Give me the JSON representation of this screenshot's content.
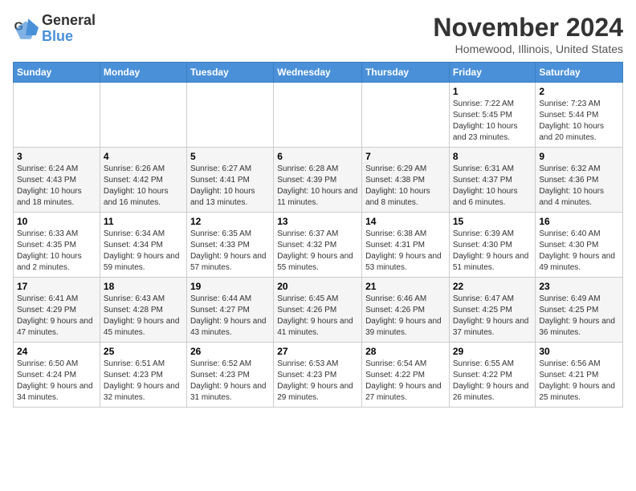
{
  "logo": {
    "general": "General",
    "blue": "Blue"
  },
  "title": {
    "month": "November 2024",
    "location": "Homewood, Illinois, United States"
  },
  "weekdays": [
    "Sunday",
    "Monday",
    "Tuesday",
    "Wednesday",
    "Thursday",
    "Friday",
    "Saturday"
  ],
  "weeks": [
    [
      {
        "day": "",
        "info": ""
      },
      {
        "day": "",
        "info": ""
      },
      {
        "day": "",
        "info": ""
      },
      {
        "day": "",
        "info": ""
      },
      {
        "day": "",
        "info": ""
      },
      {
        "day": "1",
        "info": "Sunrise: 7:22 AM\nSunset: 5:45 PM\nDaylight: 10 hours and 23 minutes."
      },
      {
        "day": "2",
        "info": "Sunrise: 7:23 AM\nSunset: 5:44 PM\nDaylight: 10 hours and 20 minutes."
      }
    ],
    [
      {
        "day": "3",
        "info": "Sunrise: 6:24 AM\nSunset: 4:43 PM\nDaylight: 10 hours and 18 minutes."
      },
      {
        "day": "4",
        "info": "Sunrise: 6:26 AM\nSunset: 4:42 PM\nDaylight: 10 hours and 16 minutes."
      },
      {
        "day": "5",
        "info": "Sunrise: 6:27 AM\nSunset: 4:41 PM\nDaylight: 10 hours and 13 minutes."
      },
      {
        "day": "6",
        "info": "Sunrise: 6:28 AM\nSunset: 4:39 PM\nDaylight: 10 hours and 11 minutes."
      },
      {
        "day": "7",
        "info": "Sunrise: 6:29 AM\nSunset: 4:38 PM\nDaylight: 10 hours and 8 minutes."
      },
      {
        "day": "8",
        "info": "Sunrise: 6:31 AM\nSunset: 4:37 PM\nDaylight: 10 hours and 6 minutes."
      },
      {
        "day": "9",
        "info": "Sunrise: 6:32 AM\nSunset: 4:36 PM\nDaylight: 10 hours and 4 minutes."
      }
    ],
    [
      {
        "day": "10",
        "info": "Sunrise: 6:33 AM\nSunset: 4:35 PM\nDaylight: 10 hours and 2 minutes."
      },
      {
        "day": "11",
        "info": "Sunrise: 6:34 AM\nSunset: 4:34 PM\nDaylight: 9 hours and 59 minutes."
      },
      {
        "day": "12",
        "info": "Sunrise: 6:35 AM\nSunset: 4:33 PM\nDaylight: 9 hours and 57 minutes."
      },
      {
        "day": "13",
        "info": "Sunrise: 6:37 AM\nSunset: 4:32 PM\nDaylight: 9 hours and 55 minutes."
      },
      {
        "day": "14",
        "info": "Sunrise: 6:38 AM\nSunset: 4:31 PM\nDaylight: 9 hours and 53 minutes."
      },
      {
        "day": "15",
        "info": "Sunrise: 6:39 AM\nSunset: 4:30 PM\nDaylight: 9 hours and 51 minutes."
      },
      {
        "day": "16",
        "info": "Sunrise: 6:40 AM\nSunset: 4:30 PM\nDaylight: 9 hours and 49 minutes."
      }
    ],
    [
      {
        "day": "17",
        "info": "Sunrise: 6:41 AM\nSunset: 4:29 PM\nDaylight: 9 hours and 47 minutes."
      },
      {
        "day": "18",
        "info": "Sunrise: 6:43 AM\nSunset: 4:28 PM\nDaylight: 9 hours and 45 minutes."
      },
      {
        "day": "19",
        "info": "Sunrise: 6:44 AM\nSunset: 4:27 PM\nDaylight: 9 hours and 43 minutes."
      },
      {
        "day": "20",
        "info": "Sunrise: 6:45 AM\nSunset: 4:26 PM\nDaylight: 9 hours and 41 minutes."
      },
      {
        "day": "21",
        "info": "Sunrise: 6:46 AM\nSunset: 4:26 PM\nDaylight: 9 hours and 39 minutes."
      },
      {
        "day": "22",
        "info": "Sunrise: 6:47 AM\nSunset: 4:25 PM\nDaylight: 9 hours and 37 minutes."
      },
      {
        "day": "23",
        "info": "Sunrise: 6:49 AM\nSunset: 4:25 PM\nDaylight: 9 hours and 36 minutes."
      }
    ],
    [
      {
        "day": "24",
        "info": "Sunrise: 6:50 AM\nSunset: 4:24 PM\nDaylight: 9 hours and 34 minutes."
      },
      {
        "day": "25",
        "info": "Sunrise: 6:51 AM\nSunset: 4:23 PM\nDaylight: 9 hours and 32 minutes."
      },
      {
        "day": "26",
        "info": "Sunrise: 6:52 AM\nSunset: 4:23 PM\nDaylight: 9 hours and 31 minutes."
      },
      {
        "day": "27",
        "info": "Sunrise: 6:53 AM\nSunset: 4:23 PM\nDaylight: 9 hours and 29 minutes."
      },
      {
        "day": "28",
        "info": "Sunrise: 6:54 AM\nSunset: 4:22 PM\nDaylight: 9 hours and 27 minutes."
      },
      {
        "day": "29",
        "info": "Sunrise: 6:55 AM\nSunset: 4:22 PM\nDaylight: 9 hours and 26 minutes."
      },
      {
        "day": "30",
        "info": "Sunrise: 6:56 AM\nSunset: 4:21 PM\nDaylight: 9 hours and 25 minutes."
      }
    ]
  ]
}
